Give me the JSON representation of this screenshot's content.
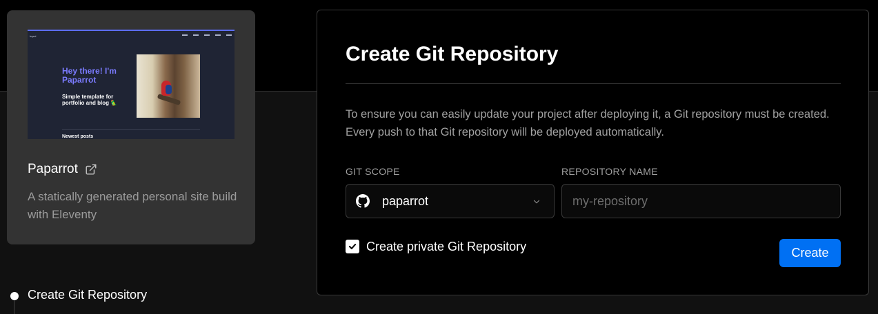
{
  "template": {
    "preview": {
      "brand": "hqxci",
      "hero_title": "Hey there! I'm Paparrot",
      "hero_subtitle": "Simple template for portfolio and blog 🦜",
      "section_heading": "Newest posts"
    },
    "name": "Paparrot",
    "description": "A statically generated personal site build with Eleventy"
  },
  "steps": [
    {
      "label": "Create Git Repository",
      "active": true
    }
  ],
  "panel": {
    "title": "Create Git Repository",
    "description": "To ensure you can easily update your project after deploying it, a Git repository must be created. Every push to that Git repository will be deployed automatically.",
    "git_scope": {
      "label": "GIT SCOPE",
      "value": "paparrot",
      "icon": "github-icon"
    },
    "repository_name": {
      "label": "REPOSITORY NAME",
      "value": "",
      "placeholder": "my-repository"
    },
    "private_checkbox": {
      "label": "Create private Git Repository",
      "checked": true
    },
    "create_button": "Create"
  },
  "colors": {
    "background": "#000000",
    "card": "#333333",
    "accent": "#0070f3",
    "muted_text": "#a1a1a1"
  }
}
